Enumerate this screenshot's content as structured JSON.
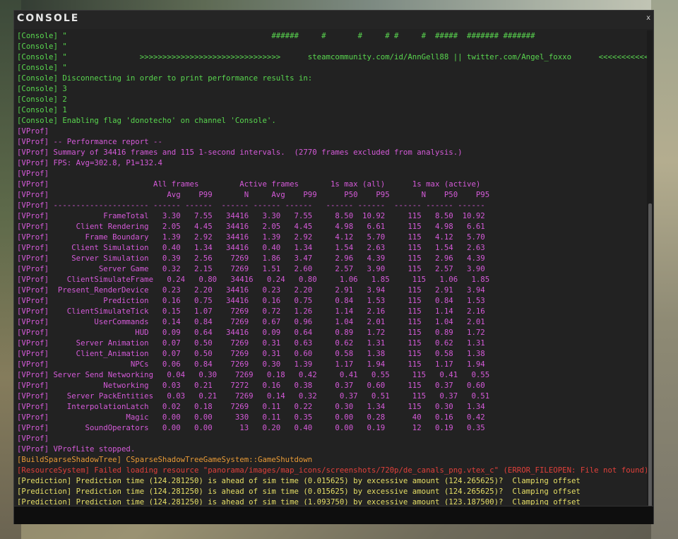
{
  "window": {
    "title": "CONSOLE",
    "close_label": "x"
  },
  "colors": {
    "console": "#59d64f",
    "vprof": "#d45ad8",
    "build": "#e89a36",
    "resource": "#e0403a",
    "prediction": "#e6df66"
  },
  "lines": [
    {
      "text": "[Console] \"                                             ######     #       #     # #     #  #####  ####### #######",
      "color": "#59d64f"
    },
    {
      "text": "[Console] \"",
      "color": "#59d64f"
    },
    {
      "text": "[Console] \"                >>>>>>>>>>>>>>>>>>>>>>>>>>>>>>>      steamcommunity.com/id/AnnGell88 || twitter.com/Angel_foxxo      <<<<<<<<<<<<<<<<<",
      "color": "#59d64f"
    },
    {
      "text": "[Console] \"",
      "color": "#59d64f"
    },
    {
      "text": "[Console] Disconnecting in order to print performance results in:",
      "color": "#59d64f"
    },
    {
      "text": "[Console] 3",
      "color": "#59d64f"
    },
    {
      "text": "[Console] 2",
      "color": "#59d64f"
    },
    {
      "text": "[Console] 1",
      "color": "#59d64f"
    },
    {
      "text": "[Console] Enabling flag 'donotecho' on channel 'Console'.",
      "color": "#59d64f"
    },
    {
      "text": "[VProf]",
      "color": "#d45ad8"
    },
    {
      "text": "[VProf] -- Performance report --",
      "color": "#d45ad8"
    },
    {
      "text": "[VProf] Summary of 34416 frames and 115 1-second intervals.  (2770 frames excluded from analysis.)",
      "color": "#d45ad8"
    },
    {
      "text": "[VProf] FPS: Avg=302.8, P1=132.4",
      "color": "#d45ad8"
    },
    {
      "text": "[VProf]",
      "color": "#d45ad8"
    },
    {
      "text": "[VProf]                       All frames         Active frames       1s max (all)      1s max (active)",
      "color": "#d45ad8"
    },
    {
      "text": "[VProf]                          Avg    P99       N     Avg    P99      P50    P95       N    P50    P95",
      "color": "#d45ad8"
    },
    {
      "text": "[VProf] --------------------- ------ ------  ------ ------ ------   ------ ------  ------ ------ ------",
      "color": "#d45ad8"
    },
    {
      "text": "[VProf]            FrameTotal   3.30   7.55   34416   3.30   7.55     8.50  10.92     115   8.50  10.92",
      "color": "#d45ad8"
    },
    {
      "text": "[VProf]      Client Rendering   2.05   4.45   34416   2.05   4.45     4.98   6.61     115   4.98   6.61",
      "color": "#d45ad8"
    },
    {
      "text": "[VProf]        Frame Boundary   1.39   2.92   34416   1.39   2.92     4.12   5.70     115   4.12   5.70",
      "color": "#d45ad8"
    },
    {
      "text": "[VProf]     Client Simulation   0.40   1.34   34416   0.40   1.34     1.54   2.63     115   1.54   2.63",
      "color": "#d45ad8"
    },
    {
      "text": "[VProf]     Server Simulation   0.39   2.56    7269   1.86   3.47     2.96   4.39     115   2.96   4.39",
      "color": "#d45ad8"
    },
    {
      "text": "[VProf]           Server Game   0.32   2.15    7269   1.51   2.60     2.57   3.90     115   2.57   3.90",
      "color": "#d45ad8"
    },
    {
      "text": "[VProf]    ClientSimulateFrame   0.24   0.80   34416   0.24   0.80     1.06   1.85     115   1.06   1.85",
      "color": "#d45ad8"
    },
    {
      "text": "[VProf]  Present_RenderDevice   0.23   2.20   34416   0.23   2.20     2.91   3.94     115   2.91   3.94",
      "color": "#d45ad8"
    },
    {
      "text": "[VProf]            Prediction   0.16   0.75   34416   0.16   0.75     0.84   1.53     115   0.84   1.53",
      "color": "#d45ad8"
    },
    {
      "text": "[VProf]    ClientSimulateTick   0.15   1.07    7269   0.72   1.26     1.14   2.16     115   1.14   2.16",
      "color": "#d45ad8"
    },
    {
      "text": "[VProf]          UserCommands   0.14   0.84    7269   0.67   0.96     1.04   2.01     115   1.04   2.01",
      "color": "#d45ad8"
    },
    {
      "text": "[VProf]                   HUD   0.09   0.64   34416   0.09   0.64     0.89   1.72     115   0.89   1.72",
      "color": "#d45ad8"
    },
    {
      "text": "[VProf]      Server Animation   0.07   0.50    7269   0.31   0.63     0.62   1.31     115   0.62   1.31",
      "color": "#d45ad8"
    },
    {
      "text": "[VProf]      Client_Animation   0.07   0.50    7269   0.31   0.60     0.58   1.38     115   0.58   1.38",
      "color": "#d45ad8"
    },
    {
      "text": "[VProf]                  NPCs   0.06   0.84    7269   0.30   1.39     1.17   1.94     115   1.17   1.94",
      "color": "#d45ad8"
    },
    {
      "text": "[VProf] Server Send Networking   0.04   0.30    7269   0.18   0.42     0.41   0.55     115   0.41   0.55",
      "color": "#d45ad8"
    },
    {
      "text": "[VProf]            Networking   0.03   0.21    7272   0.16   0.38     0.37   0.60     115   0.37   0.60",
      "color": "#d45ad8"
    },
    {
      "text": "[VProf]    Server PackEntities   0.03   0.21    7269   0.14   0.32     0.37   0.51     115   0.37   0.51",
      "color": "#d45ad8"
    },
    {
      "text": "[VProf]    InterpolationLatch   0.02   0.18    7269   0.11   0.22     0.30   1.34     115   0.30   1.34",
      "color": "#d45ad8"
    },
    {
      "text": "[VProf]                 Magic   0.00   0.00     330   0.11   0.35     0.00   0.28      40   0.16   0.42",
      "color": "#d45ad8"
    },
    {
      "text": "[VProf]        SoundOperators   0.00   0.00      13   0.20   0.40     0.00   0.19      12   0.19   0.35",
      "color": "#d45ad8"
    },
    {
      "text": "[VProf]",
      "color": "#d45ad8"
    },
    {
      "text": "[VProf] VProfLite stopped.",
      "color": "#d45ad8"
    },
    {
      "text": "[BuildSparseShadowTree] CSparseShadowTreeGameSystem::GameShutdown",
      "color": "#e89a36"
    },
    {
      "text": "[ResourceSystem] Failed loading resource \"panorama/images/map_icons/screenshots/720p/de_canals_png.vtex_c\" (ERROR_FILEOPEN: File not found)",
      "color": "#e0403a"
    },
    {
      "text": "[Prediction] Prediction time (124.281250) is ahead of sim time (0.015625) by excessive amount (124.265625)?  Clamping offset",
      "color": "#e6df66"
    },
    {
      "text": "[Prediction] Prediction time (124.281250) is ahead of sim time (0.015625) by excessive amount (124.265625)?  Clamping offset",
      "color": "#e6df66"
    },
    {
      "text": "[Prediction] Prediction time (124.281250) is ahead of sim time (1.093750) by excessive amount (123.187500)?  Clamping offset",
      "color": "#e6df66"
    }
  ],
  "input": {
    "value": ""
  }
}
